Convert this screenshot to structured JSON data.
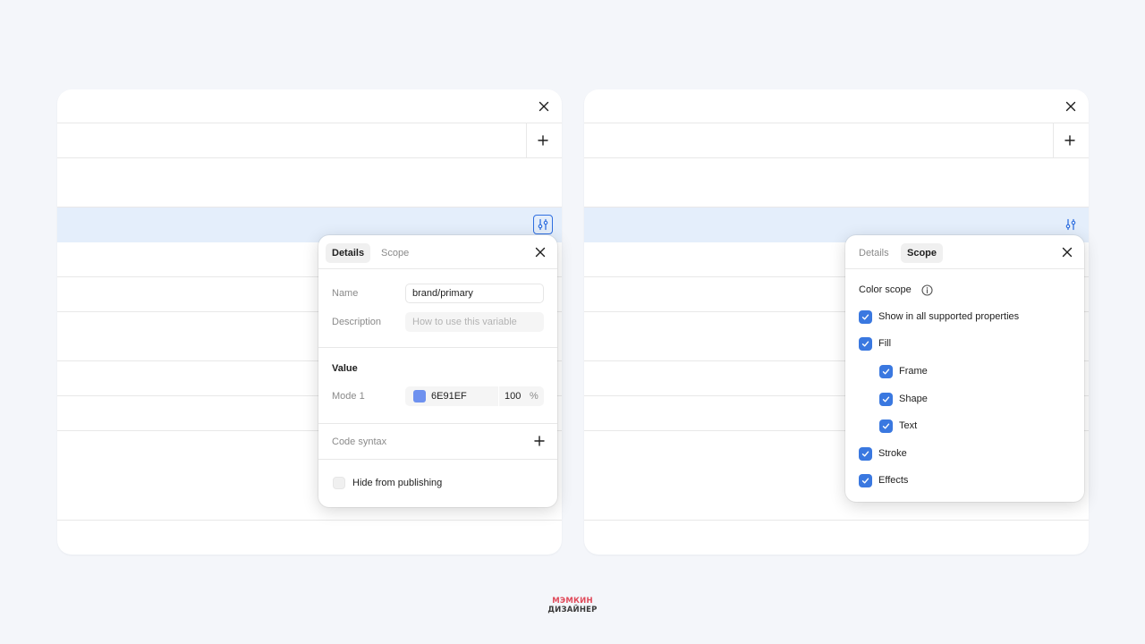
{
  "left_popover": {
    "tabs": [
      {
        "label": "Details",
        "active": true
      },
      {
        "label": "Scope",
        "active": false
      }
    ],
    "name_label": "Name",
    "name_value": "brand/primary",
    "description_label": "Description",
    "description_placeholder": "How to use this variable",
    "value_heading": "Value",
    "mode_label": "Mode 1",
    "swatch_color": "#6E91EF",
    "hex_value": "6E91EF",
    "opacity_value": "100",
    "opacity_unit": "%",
    "code_syntax_label": "Code syntax",
    "hide_label": "Hide from publishing"
  },
  "right_popover": {
    "tabs": [
      {
        "label": "Details",
        "active": false
      },
      {
        "label": "Scope",
        "active": true
      }
    ],
    "heading": "Color scope",
    "options": [
      {
        "label": "Show in all supported properties",
        "checked": true,
        "indent": 0
      },
      {
        "label": "Fill",
        "checked": true,
        "indent": 0
      },
      {
        "label": "Frame",
        "checked": true,
        "indent": 1
      },
      {
        "label": "Shape",
        "checked": true,
        "indent": 1
      },
      {
        "label": "Text",
        "checked": true,
        "indent": 1
      },
      {
        "label": "Stroke",
        "checked": true,
        "indent": 0
      },
      {
        "label": "Effects",
        "checked": true,
        "indent": 0
      }
    ]
  },
  "logo": {
    "line1": "МЭМКИН",
    "line2": "ДИЗАЙНЕР"
  },
  "colors": {
    "accent": "#3A78E0",
    "highlight": "#E4EEFB",
    "logo_red": "#E04A5A"
  },
  "icons": [
    "close-icon",
    "plus-icon",
    "sliders-icon",
    "info-icon",
    "check-icon"
  ]
}
